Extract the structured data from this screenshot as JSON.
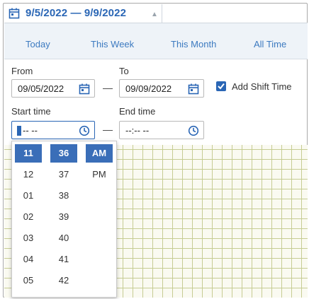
{
  "header": {
    "date_range": "9/5/2022 — 9/9/2022",
    "caret": "▲"
  },
  "tabs": [
    {
      "label": "Today"
    },
    {
      "label": "This Week"
    },
    {
      "label": "This Month"
    },
    {
      "label": "All Time"
    }
  ],
  "from": {
    "label": "From",
    "value": "09/05/2022"
  },
  "to": {
    "label": "To",
    "value": "09/09/2022"
  },
  "range_separator": "—",
  "add_shift_time": {
    "label": "Add Shift Time",
    "checked": true
  },
  "start_time": {
    "label": "Start time",
    "value": "-- --"
  },
  "end_time": {
    "label": "End time",
    "value": "--:-- --"
  },
  "picker": {
    "hours": [
      "11",
      "12",
      "01",
      "02",
      "03",
      "04",
      "05"
    ],
    "minutes": [
      "36",
      "37",
      "38",
      "39",
      "40",
      "41",
      "42"
    ],
    "meridiem": [
      "AM",
      "PM"
    ],
    "selected": {
      "hour": "11",
      "minute": "36",
      "meridiem": "AM"
    }
  },
  "colors": {
    "accent": "#2a66b5",
    "selected_cell": "#3a6eb8",
    "grid_line": "#c6cc93"
  }
}
